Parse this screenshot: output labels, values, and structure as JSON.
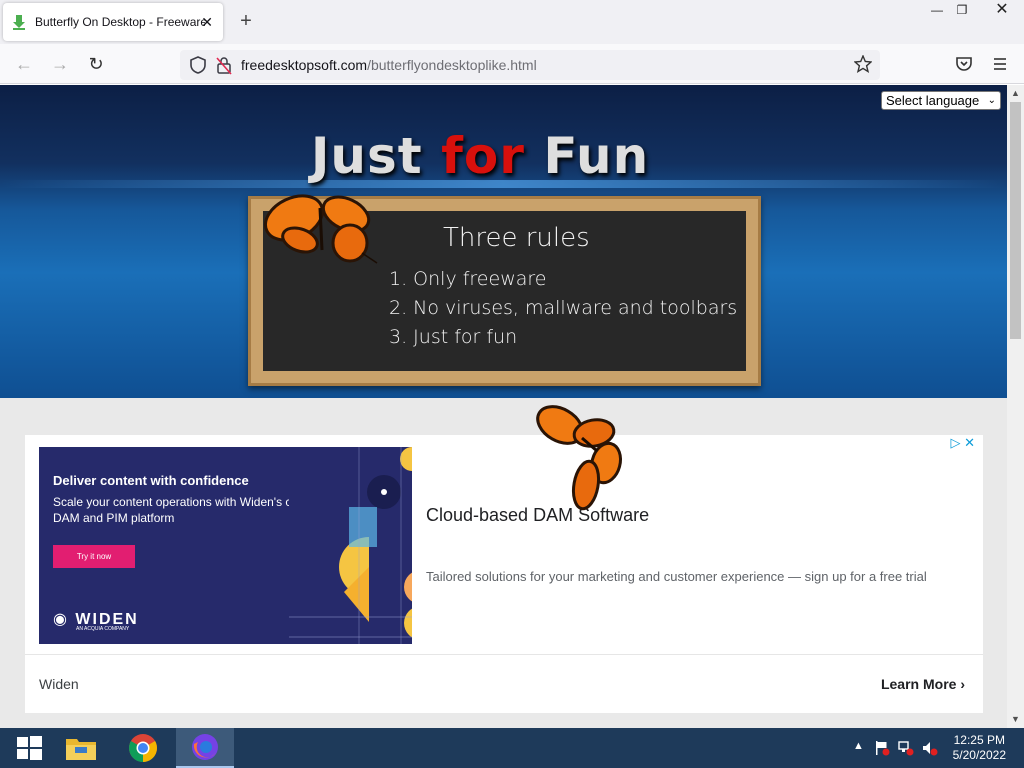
{
  "browser": {
    "tab_title": "Butterfly On Desktop - Freeware",
    "url_host": "freedesktopsoft.com",
    "url_path": "/butterflyondesktoplike.html"
  },
  "page": {
    "language_select": "Select language",
    "headline_1": "Just",
    "headline_2": "for",
    "headline_3": "Fun",
    "board": {
      "heading": "Three rules",
      "rules": [
        "1. Only freeware",
        "2. No viruses, mallware and toolbars",
        "3. Just for fun"
      ]
    },
    "ad": {
      "image_headline": "Deliver content with confidence",
      "image_sub": "Scale your content operations with Widen's combined DAM and PIM platform",
      "image_button": "Try it now",
      "image_logo": "WIDEN",
      "image_logo_sub": "AN ACQUIA COMPANY",
      "title": "Cloud-based DAM Software",
      "description": "Tailored solutions for your marketing and customer experience — sign up for a free trial",
      "advertiser": "Widen",
      "cta": "Learn More"
    }
  },
  "taskbar": {
    "time": "12:25 PM",
    "date": "5/20/2022"
  },
  "colors": {
    "headline_red": "#d8100c",
    "ad_button": "#e21e71",
    "taskbar": "#1e3a5a"
  }
}
